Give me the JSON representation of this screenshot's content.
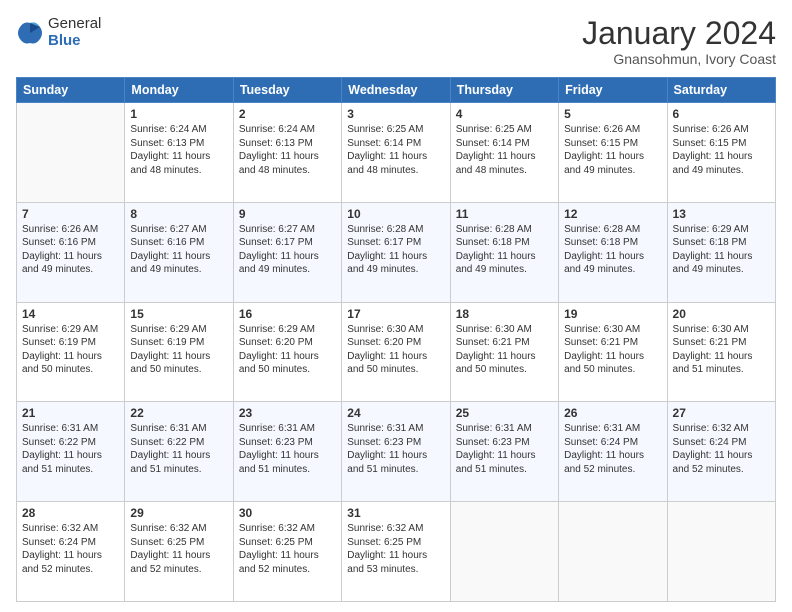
{
  "logo": {
    "general": "General",
    "blue": "Blue"
  },
  "header": {
    "title": "January 2024",
    "subtitle": "Gnansohmun, Ivory Coast"
  },
  "weekdays": [
    "Sunday",
    "Monday",
    "Tuesday",
    "Wednesday",
    "Thursday",
    "Friday",
    "Saturday"
  ],
  "weeks": [
    [
      {
        "day": "",
        "info": ""
      },
      {
        "day": "1",
        "info": "Sunrise: 6:24 AM\nSunset: 6:13 PM\nDaylight: 11 hours\nand 48 minutes."
      },
      {
        "day": "2",
        "info": "Sunrise: 6:24 AM\nSunset: 6:13 PM\nDaylight: 11 hours\nand 48 minutes."
      },
      {
        "day": "3",
        "info": "Sunrise: 6:25 AM\nSunset: 6:14 PM\nDaylight: 11 hours\nand 48 minutes."
      },
      {
        "day": "4",
        "info": "Sunrise: 6:25 AM\nSunset: 6:14 PM\nDaylight: 11 hours\nand 48 minutes."
      },
      {
        "day": "5",
        "info": "Sunrise: 6:26 AM\nSunset: 6:15 PM\nDaylight: 11 hours\nand 49 minutes."
      },
      {
        "day": "6",
        "info": "Sunrise: 6:26 AM\nSunset: 6:15 PM\nDaylight: 11 hours\nand 49 minutes."
      }
    ],
    [
      {
        "day": "7",
        "info": "Sunrise: 6:26 AM\nSunset: 6:16 PM\nDaylight: 11 hours\nand 49 minutes."
      },
      {
        "day": "8",
        "info": "Sunrise: 6:27 AM\nSunset: 6:16 PM\nDaylight: 11 hours\nand 49 minutes."
      },
      {
        "day": "9",
        "info": "Sunrise: 6:27 AM\nSunset: 6:17 PM\nDaylight: 11 hours\nand 49 minutes."
      },
      {
        "day": "10",
        "info": "Sunrise: 6:28 AM\nSunset: 6:17 PM\nDaylight: 11 hours\nand 49 minutes."
      },
      {
        "day": "11",
        "info": "Sunrise: 6:28 AM\nSunset: 6:18 PM\nDaylight: 11 hours\nand 49 minutes."
      },
      {
        "day": "12",
        "info": "Sunrise: 6:28 AM\nSunset: 6:18 PM\nDaylight: 11 hours\nand 49 minutes."
      },
      {
        "day": "13",
        "info": "Sunrise: 6:29 AM\nSunset: 6:18 PM\nDaylight: 11 hours\nand 49 minutes."
      }
    ],
    [
      {
        "day": "14",
        "info": "Sunrise: 6:29 AM\nSunset: 6:19 PM\nDaylight: 11 hours\nand 50 minutes."
      },
      {
        "day": "15",
        "info": "Sunrise: 6:29 AM\nSunset: 6:19 PM\nDaylight: 11 hours\nand 50 minutes."
      },
      {
        "day": "16",
        "info": "Sunrise: 6:29 AM\nSunset: 6:20 PM\nDaylight: 11 hours\nand 50 minutes."
      },
      {
        "day": "17",
        "info": "Sunrise: 6:30 AM\nSunset: 6:20 PM\nDaylight: 11 hours\nand 50 minutes."
      },
      {
        "day": "18",
        "info": "Sunrise: 6:30 AM\nSunset: 6:21 PM\nDaylight: 11 hours\nand 50 minutes."
      },
      {
        "day": "19",
        "info": "Sunrise: 6:30 AM\nSunset: 6:21 PM\nDaylight: 11 hours\nand 50 minutes."
      },
      {
        "day": "20",
        "info": "Sunrise: 6:30 AM\nSunset: 6:21 PM\nDaylight: 11 hours\nand 51 minutes."
      }
    ],
    [
      {
        "day": "21",
        "info": "Sunrise: 6:31 AM\nSunset: 6:22 PM\nDaylight: 11 hours\nand 51 minutes."
      },
      {
        "day": "22",
        "info": "Sunrise: 6:31 AM\nSunset: 6:22 PM\nDaylight: 11 hours\nand 51 minutes."
      },
      {
        "day": "23",
        "info": "Sunrise: 6:31 AM\nSunset: 6:23 PM\nDaylight: 11 hours\nand 51 minutes."
      },
      {
        "day": "24",
        "info": "Sunrise: 6:31 AM\nSunset: 6:23 PM\nDaylight: 11 hours\nand 51 minutes."
      },
      {
        "day": "25",
        "info": "Sunrise: 6:31 AM\nSunset: 6:23 PM\nDaylight: 11 hours\nand 51 minutes."
      },
      {
        "day": "26",
        "info": "Sunrise: 6:31 AM\nSunset: 6:24 PM\nDaylight: 11 hours\nand 52 minutes."
      },
      {
        "day": "27",
        "info": "Sunrise: 6:32 AM\nSunset: 6:24 PM\nDaylight: 11 hours\nand 52 minutes."
      }
    ],
    [
      {
        "day": "28",
        "info": "Sunrise: 6:32 AM\nSunset: 6:24 PM\nDaylight: 11 hours\nand 52 minutes."
      },
      {
        "day": "29",
        "info": "Sunrise: 6:32 AM\nSunset: 6:25 PM\nDaylight: 11 hours\nand 52 minutes."
      },
      {
        "day": "30",
        "info": "Sunrise: 6:32 AM\nSunset: 6:25 PM\nDaylight: 11 hours\nand 52 minutes."
      },
      {
        "day": "31",
        "info": "Sunrise: 6:32 AM\nSunset: 6:25 PM\nDaylight: 11 hours\nand 53 minutes."
      },
      {
        "day": "",
        "info": ""
      },
      {
        "day": "",
        "info": ""
      },
      {
        "day": "",
        "info": ""
      }
    ]
  ]
}
